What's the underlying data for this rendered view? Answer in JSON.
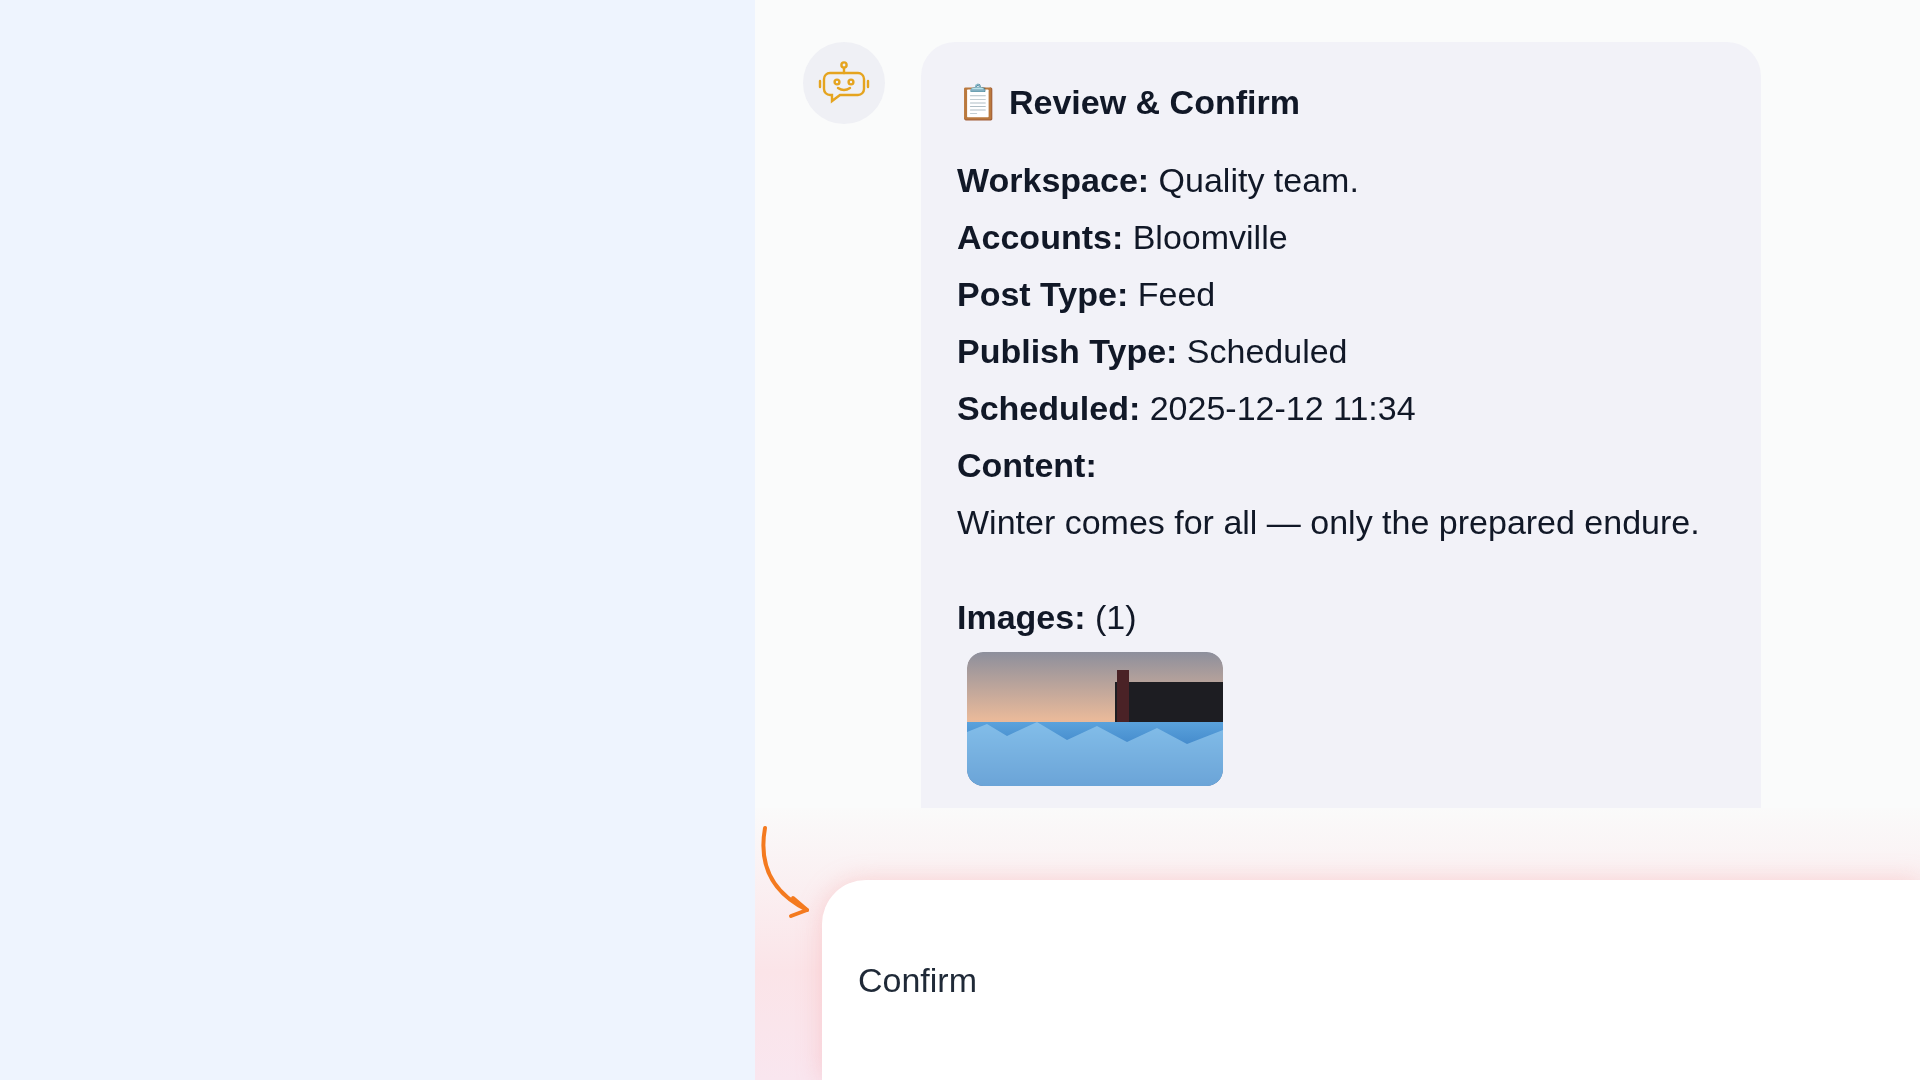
{
  "message": {
    "title_icon": "📋",
    "title": "Review & Confirm",
    "fields": [
      {
        "label": "Workspace:",
        "value": "Quality team."
      },
      {
        "label": "Accounts:",
        "value": "Bloomville"
      },
      {
        "label": "Post Type:",
        "value": "Feed"
      },
      {
        "label": "Publish Type:",
        "value": "Scheduled"
      },
      {
        "label": "Scheduled:",
        "value": "2025-12-12 11:34"
      }
    ],
    "content_label": "Content:",
    "content": "Winter comes for all — only the prepared endure.",
    "images_label": "Images:",
    "images_count": "(1)"
  },
  "composer": {
    "value": "Confirm"
  }
}
